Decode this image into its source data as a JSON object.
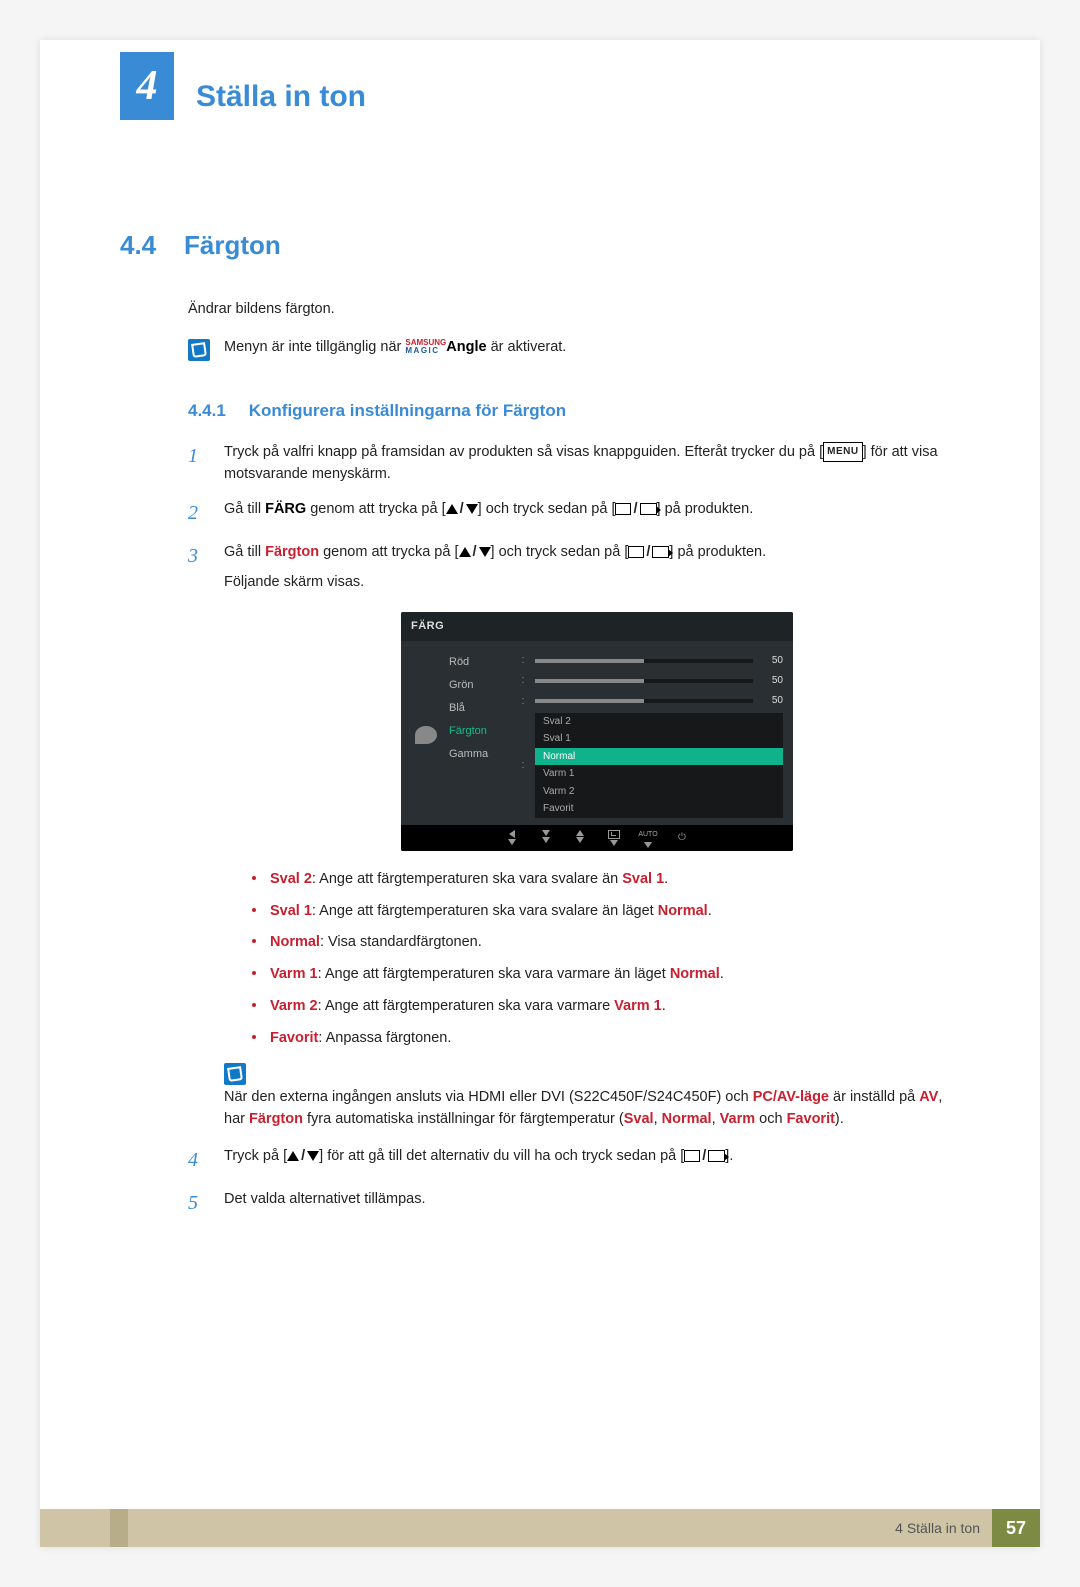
{
  "chapter": {
    "number": "4",
    "title": "Ställa in ton"
  },
  "section": {
    "number": "4.4",
    "title": "Färgton",
    "intro": "Ändrar bildens färgton."
  },
  "note1": {
    "pre": "Menyn är inte tillgänglig när ",
    "brand_top": "SAMSUNG",
    "brand_bot": "MAGIC",
    "brand_word": "Angle",
    "post": " är aktiverat."
  },
  "subsection": {
    "number": "4.4.1",
    "title": "Konfigurera inställningarna för Färgton"
  },
  "steps": {
    "s1": {
      "a": "Tryck på valfri knapp på framsidan av produkten så visas knappguiden. Efteråt trycker du på [",
      "menu": "MENU",
      "b": "] för att visa motsvarande menyskärm."
    },
    "s2": {
      "a": "Gå till ",
      "kw": "FÄRG",
      "b": " genom att trycka på [",
      "c": "] och tryck sedan på [",
      "d": "] på produkten."
    },
    "s3": {
      "a": "Gå till ",
      "kw": "Färgton",
      "b": " genom att trycka på [",
      "c": "] och tryck sedan på [",
      "d": "] på produkten.",
      "e": "Följande skärm visas."
    },
    "s4": {
      "a": "Tryck på [",
      "b": "] för att gå till det alternativ du vill ha och tryck sedan på [",
      "c": "]."
    },
    "s5": {
      "a": "Det valda alternativet tillämpas."
    }
  },
  "osd": {
    "title": "FÄRG",
    "labels": {
      "rod": "Röd",
      "gron": "Grön",
      "bla": "Blå",
      "fargton": "Färgton",
      "gamma": "Gamma"
    },
    "vals": {
      "rod": "50",
      "gron": "50",
      "bla": "50"
    },
    "opts": {
      "sval2": "Sval 2",
      "sval1": "Sval 1",
      "normal": "Normal",
      "varm1": "Varm 1",
      "varm2": "Varm 2",
      "favorit": "Favorit"
    },
    "footer_auto": "AUTO"
  },
  "bullets": {
    "b1": {
      "k": "Sval 2",
      "t": ": Ange att färgtemperaturen ska vara svalare än ",
      "k2": "Sval 1",
      "t2": "."
    },
    "b2": {
      "k": "Sval 1",
      "t": ": Ange att färgtemperaturen ska vara svalare än läget ",
      "k2": "Normal",
      "t2": "."
    },
    "b3": {
      "k": "Normal",
      "t": ": Visa standardfärgtonen."
    },
    "b4": {
      "k": "Varm 1",
      "t": ": Ange att färgtemperaturen ska vara varmare än läget ",
      "k2": "Normal",
      "t2": "."
    },
    "b5": {
      "k": "Varm 2",
      "t": ": Ange att färgtemperaturen ska vara varmare ",
      "k2": "Varm 1",
      "t2": "."
    },
    "b6": {
      "k": "Favorit",
      "t": ": Anpassa färgtonen."
    }
  },
  "note2": {
    "a": "När den externa ingången ansluts via HDMI eller DVI (S22C450F/S24C450F) och ",
    "k1": "PC/AV-läge",
    "b": " är inställd på ",
    "k2": "AV",
    "c": ", har ",
    "k3": "Färgton",
    "d": " fyra automatiska inställningar för färgtemperatur (",
    "k4": "Sval",
    "e": ", ",
    "k5": "Normal",
    "f": ", ",
    "k6": "Varm",
    "g": " och ",
    "k7": "Favorit",
    "h": ")."
  },
  "footer": {
    "text": "4 Ställa in ton",
    "page": "57"
  }
}
